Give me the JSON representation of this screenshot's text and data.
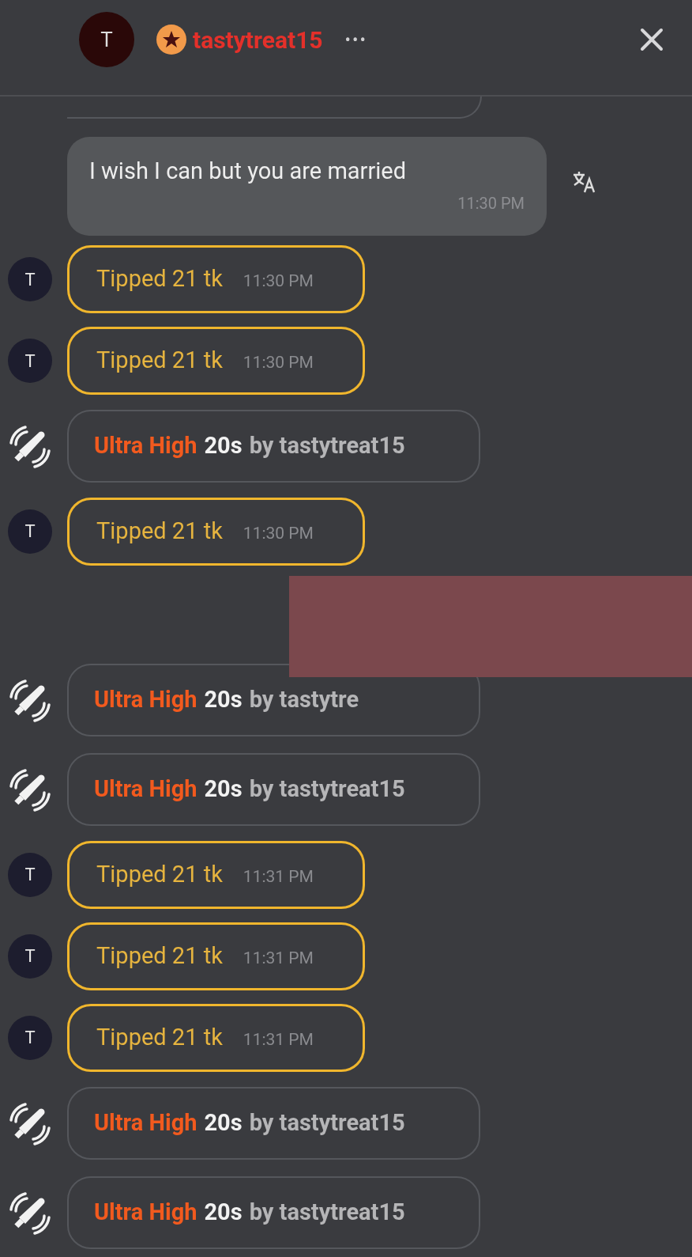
{
  "header": {
    "avatar_letter": "T",
    "username": "tastytreat15",
    "more": "•••"
  },
  "messages": [
    {
      "kind": "cut"
    },
    {
      "kind": "text",
      "text": "I wish I can but you are married",
      "time": "11:30 PM"
    },
    {
      "kind": "tip",
      "avatar_letter": "T",
      "text": "Tipped 21 tk",
      "time": "11:30 PM"
    },
    {
      "kind": "tip",
      "avatar_letter": "T",
      "text": "Tipped 21 tk",
      "time": "11:30 PM"
    },
    {
      "kind": "vibe",
      "level_label": "Ultra High",
      "duration": "20s",
      "by_text": "by tastytreat15"
    },
    {
      "kind": "tip",
      "avatar_letter": "T",
      "text": "Tipped 21 tk",
      "time": "11:30 PM"
    },
    {
      "kind": "redacted"
    },
    {
      "kind": "vibe",
      "level_label": "Ultra High",
      "duration": "20s",
      "by_text": "by tastytre"
    },
    {
      "kind": "vibe",
      "level_label": "Ultra High",
      "duration": "20s",
      "by_text": "by tastytreat15"
    },
    {
      "kind": "tip",
      "avatar_letter": "T",
      "text": "Tipped 21 tk",
      "time": "11:31 PM"
    },
    {
      "kind": "tip",
      "avatar_letter": "T",
      "text": "Tipped 21 tk",
      "time": "11:31 PM"
    },
    {
      "kind": "tip",
      "avatar_letter": "T",
      "text": "Tipped 21 tk",
      "time": "11:31 PM"
    },
    {
      "kind": "vibe",
      "level_label": "Ultra High",
      "duration": "20s",
      "by_text": "by tastytreat15"
    },
    {
      "kind": "vibe",
      "level_label": "Ultra High",
      "duration": "20s",
      "by_text": "by tastytreat15"
    }
  ]
}
